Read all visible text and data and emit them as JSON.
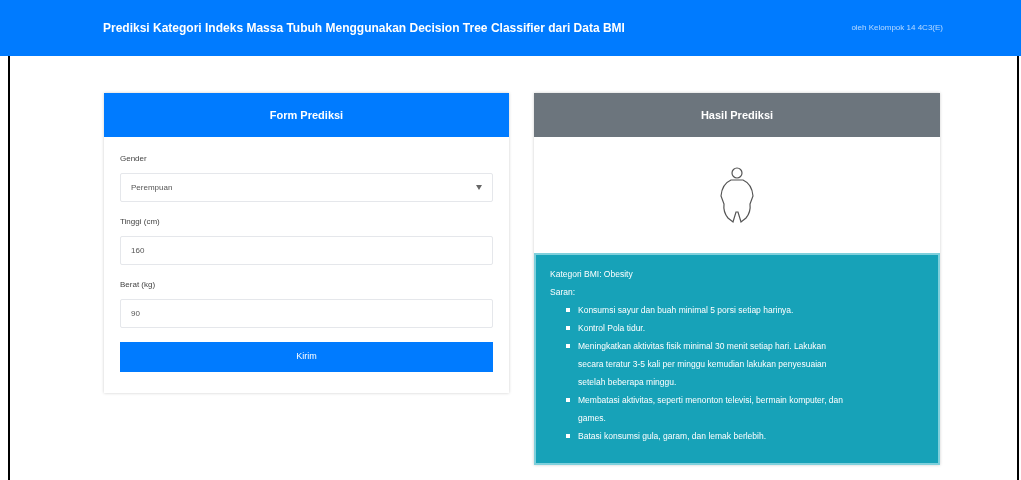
{
  "navbar": {
    "title": "Prediksi Kategori Indeks Massa Tubuh Menggunakan Decision Tree Classifier dari Data BMI",
    "author": "oleh Kelompok 14 4C3(E)"
  },
  "form": {
    "title": "Form Prediksi",
    "fields": [
      {
        "kind": "select",
        "label": "Gender",
        "value": "Perempuan"
      },
      {
        "kind": "input",
        "label": "Tinggi (cm)",
        "value": "160"
      },
      {
        "kind": "input",
        "label": "Berat (kg)",
        "value": "90"
      }
    ],
    "submit": "Kirim"
  },
  "result": {
    "title": "Hasil Prediksi",
    "category": "Kategori BMI: Obesity",
    "advice_label": "Saran:",
    "advice": [
      "Konsumsi sayur dan buah minimal 5 porsi setiap harinya.",
      "Kontrol Pola tidur.",
      "Meningkatkan aktivitas fisik minimal 30 menit setiap hari. Lakukan secara teratur 3-5 kali per minggu kemudian lakukan penyesuaian setelah beberapa minggu.",
      "Membatasi aktivitas, seperti menonton televisi, bermain komputer, dan games.",
      "Batasi konsumsi gula, garam, dan lemak berlebih."
    ]
  }
}
